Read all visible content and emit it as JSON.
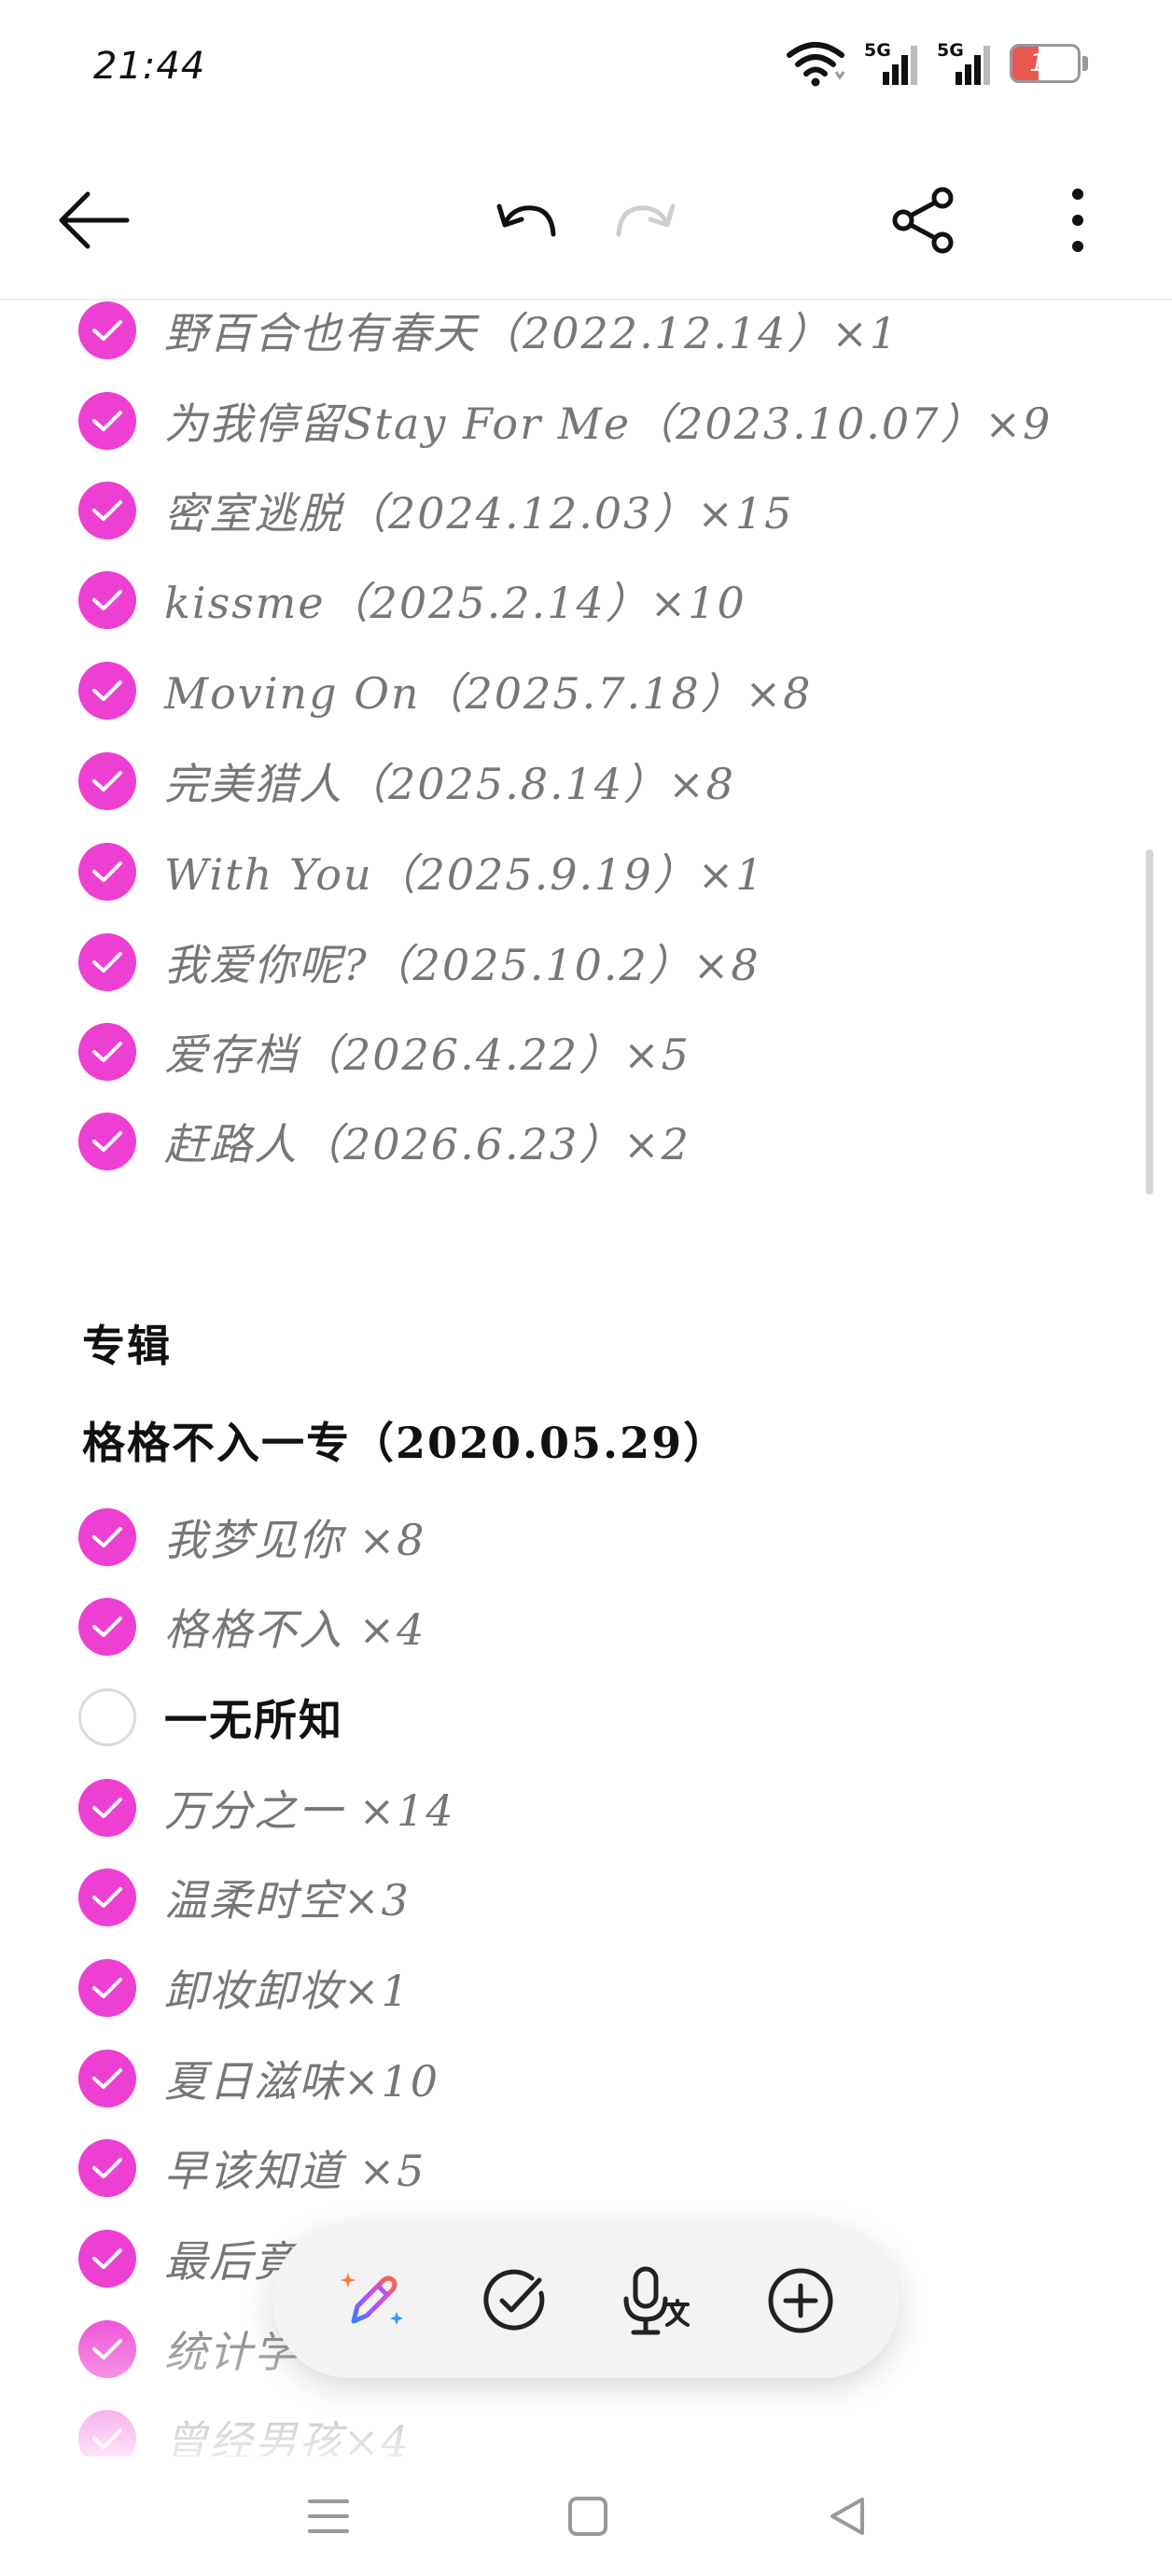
{
  "status_bar": {
    "time": "21:44",
    "network_1": "5G",
    "network_2": "5G",
    "battery_level": "16",
    "battery_color": "#e8584f"
  },
  "toolbar": {
    "back_icon": "arrow-left-icon",
    "undo_icon": "undo-icon",
    "redo_icon": "redo-icon",
    "share_icon": "share-icon",
    "more_icon": "more-vertical-icon"
  },
  "note": {
    "accent_color": "#ee3fd3",
    "singles": [
      {
        "text": "野百合也有春天（2022.12.14）×1",
        "checked": true
      },
      {
        "text": "为我停留Stay For Me（2023.10.07）×9",
        "checked": true
      },
      {
        "text": "密室逃脱（2024.12.03）×15",
        "checked": true
      },
      {
        "text": "kissme（2025.2.14）×10",
        "checked": true
      },
      {
        "text": "Moving On（2025.7.18）×8",
        "checked": true
      },
      {
        "text": "完美猎人（2025.8.14）×8",
        "checked": true
      },
      {
        "text": "With You（2025.9.19）×1",
        "checked": true
      },
      {
        "text": "我爱你呢?（2025.10.2）×8",
        "checked": true
      },
      {
        "text": "爱存档（2026.4.22）×5",
        "checked": true
      },
      {
        "text": "赶路人（2026.6.23）×2",
        "checked": true
      }
    ],
    "section_title": "专辑",
    "album_title": "格格不入一专（2020.05.29）",
    "album_tracks": [
      {
        "text": "我梦见你 ×8",
        "checked": true
      },
      {
        "text": "格格不入 ×4",
        "checked": true
      },
      {
        "text": "一无所知",
        "checked": false
      },
      {
        "text": "万分之一 ×14",
        "checked": true
      },
      {
        "text": "温柔时空×3",
        "checked": true
      },
      {
        "text": "卸妆卸妆×1",
        "checked": true
      },
      {
        "text": "夏日滋味×10",
        "checked": true
      },
      {
        "text": "早该知道 ×5",
        "checked": true
      },
      {
        "text": "最后竟",
        "checked": true
      },
      {
        "text": "统计学",
        "checked": true
      },
      {
        "text": "曾经男孩×4",
        "checked": true
      }
    ]
  },
  "fab_bar": {
    "ai_icon": "ai-pen-icon",
    "checklist_icon": "checklist-icon",
    "voice_icon": "voice-to-text-icon",
    "add_icon": "add-circle-icon"
  },
  "nav_bar": {
    "menu_icon": "menu-icon",
    "home_icon": "home-square-icon",
    "back_icon": "back-triangle-icon"
  }
}
